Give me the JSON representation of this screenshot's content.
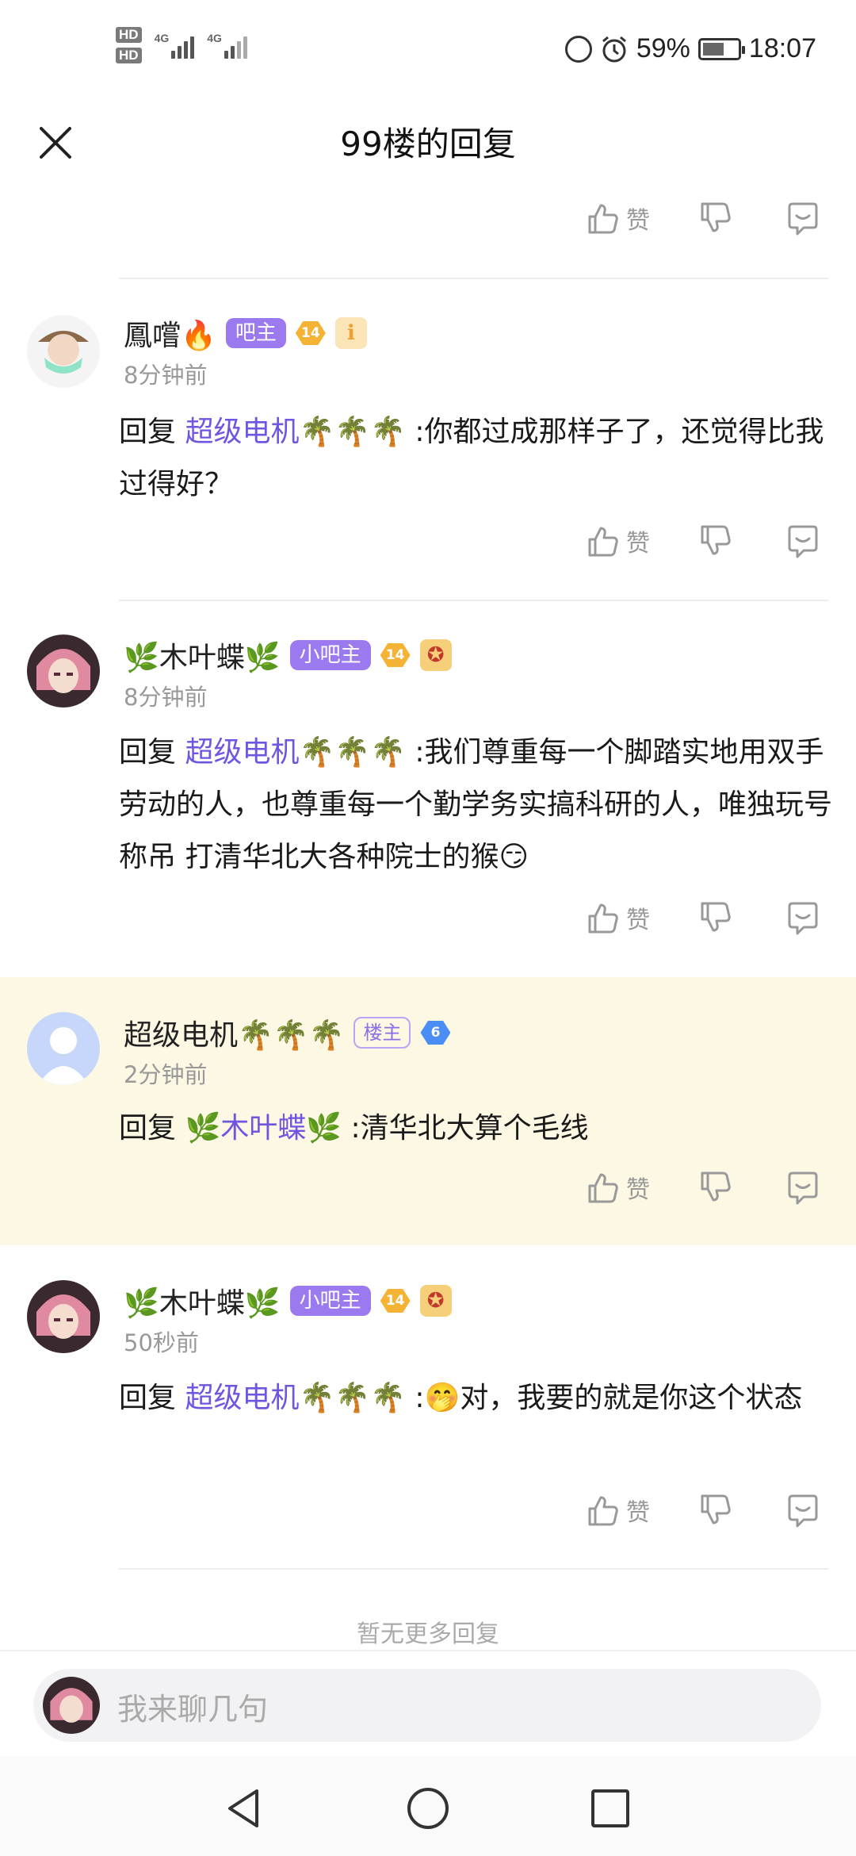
{
  "status_bar": {
    "sim1": "HD",
    "sim2": "HD",
    "net1": "4G",
    "net2": "4G",
    "battery_percent": "59%",
    "battery_level": 0.59,
    "time": "18:07"
  },
  "header": {
    "title": "99楼的回复"
  },
  "actions": {
    "like_label": "赞"
  },
  "comments": [
    {
      "username": "鳳嚐🔥",
      "badge": "吧主",
      "level": "14",
      "medal": "ℹ",
      "time": "8分钟前",
      "reply_prefix": "回复 ",
      "reply_target": "超级电机🌴🌴🌴",
      "content": " :你都过成那样子了，还觉得比我过得好？"
    },
    {
      "username": "🌿木叶蝶🌿",
      "badge": "小吧主",
      "level": "14",
      "medal": "✪",
      "time": "8分钟前",
      "reply_prefix": "回复 ",
      "reply_target": "超级电机🌴🌴🌴",
      "content": " :我们尊重每一个脚踏实地用双手劳动的人，也尊重每一个勤学务实搞科研的人，唯独玩号称吊 打清华北大各种院士的猴😏"
    },
    {
      "username": "超级电机🌴🌴🌴",
      "badge": "楼主",
      "level": "6",
      "time": "2分钟前",
      "reply_prefix": "回复 ",
      "reply_target": "🌿木叶蝶🌿",
      "content": " :清华北大算个毛线"
    },
    {
      "username": "🌿木叶蝶🌿",
      "badge": "小吧主",
      "level": "14",
      "medal": "✪",
      "time": "50秒前",
      "reply_prefix": "回复 ",
      "reply_target": "超级电机🌴🌴🌴",
      "content": " :🤭对，我要的就是你这个状态"
    }
  ],
  "no_more": "暂无更多回复",
  "input": {
    "placeholder": "我来聊几句"
  },
  "colors": {
    "accent": "#6f55e0",
    "badge_purple": "#9b7af0",
    "highlight_bg": "#fdf8e4"
  }
}
